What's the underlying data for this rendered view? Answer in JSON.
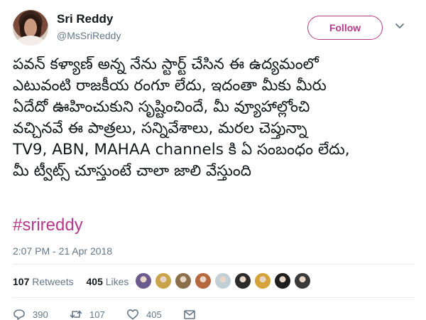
{
  "user": {
    "display_name": "Sri Reddy",
    "handle": "@MsSriReddy",
    "follow_label": "Follow"
  },
  "tweet": {
    "lines": [
      "పవన్ కళ్యాణ్ అన్న నేను స్టార్ట్ చేసిన ఈ ఉద్యమంలో",
      "ఎటువంటి రాజకీయ రంగూ లేదు, ఇదంతా మీకు మీరు",
      "ఏదేదో ఊహించుకుని సృష్టించిందే, మీ వ్యూహాల్లోంచి",
      "వచ్చినవే ఈ పాత్రలు, సన్నివేశాలు, మరల చెప్తున్నా",
      "TV9, ABN, MAHAA channels కి ఏ సంబంధం లేదు,",
      "మీ ట్వీట్స్ చూస్తుంటే చాలా జాలి వేస్తుంది"
    ],
    "hashtag": "#srireddy",
    "timestamp": "2:07 PM - 21 Apr 2018"
  },
  "stats": {
    "retweets_count": "107",
    "retweets_label": "Retweets",
    "likes_count": "405",
    "likes_label": "Likes"
  },
  "likers": [
    {
      "icon": "avatar",
      "color": "#6b5a8e"
    },
    {
      "icon": "avatar",
      "color": "#c9a44a"
    },
    {
      "icon": "avatar",
      "color": "#8a6f4a"
    },
    {
      "icon": "avatar",
      "color": "#b5673e"
    },
    {
      "icon": "avatar",
      "color": "#c3cfd6"
    },
    {
      "icon": "avatar",
      "color": "#2b2b2b"
    },
    {
      "icon": "avatar",
      "color": "#d4a33a"
    },
    {
      "icon": "avatar",
      "color": "#1e1e1e"
    },
    {
      "icon": "avatar",
      "color": "#3a3a3a"
    }
  ],
  "actions": {
    "reply_count": "390",
    "retweet_count": "107",
    "like_count": "405"
  },
  "colors": {
    "accent": "#b6398a",
    "secondary_text": "#657786"
  }
}
